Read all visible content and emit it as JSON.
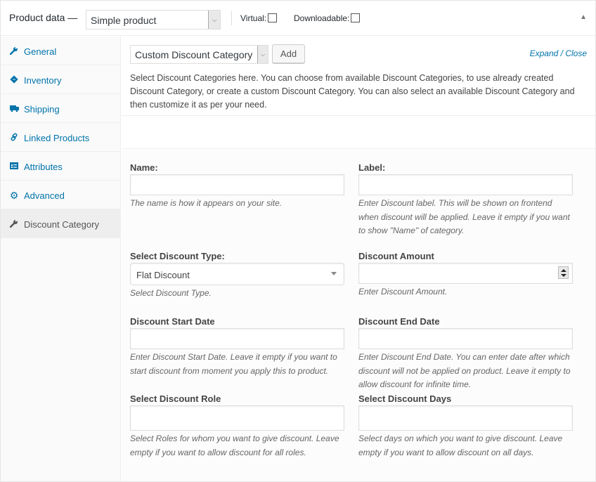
{
  "header": {
    "title": "Product data —",
    "product_type": "Simple product",
    "virtual_label": "Virtual:",
    "virtual_checked": false,
    "downloadable_label": "Downloadable:",
    "downloadable_checked": false,
    "collapse_icon": "▲"
  },
  "sidebar": {
    "items": [
      {
        "label": "General",
        "icon": "wrench-icon",
        "glyph": "🔧",
        "active": false
      },
      {
        "label": "Inventory",
        "icon": "tag-icon",
        "glyph": "◆",
        "active": false
      },
      {
        "label": "Shipping",
        "icon": "truck-icon",
        "glyph": "■",
        "active": false
      },
      {
        "label": "Linked Products",
        "icon": "link-icon",
        "glyph": "∞",
        "active": false
      },
      {
        "label": "Attributes",
        "icon": "list-icon",
        "glyph": "▤",
        "active": false
      },
      {
        "label": "Advanced",
        "icon": "gear-icon",
        "glyph": "⚙",
        "active": false
      },
      {
        "label": "Discount Category",
        "icon": "wrench-icon",
        "glyph": "🔧",
        "active": true
      }
    ]
  },
  "toolbar": {
    "category_select": "Custom Discount Category",
    "add_label": "Add",
    "expand_label": "Expand",
    "expand_sep": " / ",
    "close_label": "Close"
  },
  "description": "Select Discount Categories here. You can choose from available Discount Categories, to use already created Discount Category, or create a custom Discount Category. You can also select an available Discount Category and then customize it as per your need.",
  "form": {
    "name": {
      "label": "Name:",
      "value": "",
      "help": "The name is how it appears on your site."
    },
    "label": {
      "label": "Label:",
      "value": "",
      "help": "Enter Discount label. This will be shown on frontend when discount will be applied. Leave it empty if you want to show \"Name\" of category."
    },
    "discount_type": {
      "label": "Select Discount Type:",
      "value": "Flat Discount",
      "help": "Select Discount Type."
    },
    "discount_amount": {
      "label": "Discount Amount",
      "value": "",
      "help": "Enter Discount Amount."
    },
    "start_date": {
      "label": "Discount Start Date",
      "value": "",
      "help": "Enter Discount Start Date. Leave it empty if you want to start discount from moment you apply this to product."
    },
    "end_date": {
      "label": "Discount End Date",
      "value": "",
      "help": "Enter Discount End Date. You can enter date after which discount will not be applied on product. Leave it empty to allow discount for infinite time."
    },
    "role": {
      "label": "Select Discount Role",
      "value": "",
      "help": "Select Roles for whom you want to give discount. Leave empty if you want to allow discount for all roles."
    },
    "days": {
      "label": "Select Discount Days",
      "value": "",
      "help": "Select days on which you want to give discount. Leave empty if you want to allow discount on all days."
    }
  }
}
